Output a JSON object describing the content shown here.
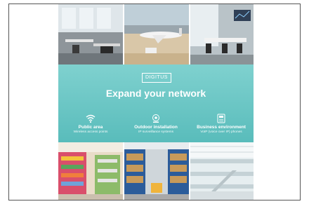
{
  "banner": {
    "brand": "DIGITUS",
    "headline": "Expand your network",
    "features": [
      {
        "title": "Public area",
        "subtitle": "Wireless access points",
        "icon": "wifi-icon"
      },
      {
        "title": "Outdoor installation",
        "subtitle": "IP surveillance systems",
        "icon": "camera-icon"
      },
      {
        "title": "Business environment",
        "subtitle": "VoIP (voice over IP) phones",
        "icon": "phone-icon"
      }
    ],
    "colors": {
      "teal": "#59bcbb",
      "text": "#ffffff"
    }
  }
}
